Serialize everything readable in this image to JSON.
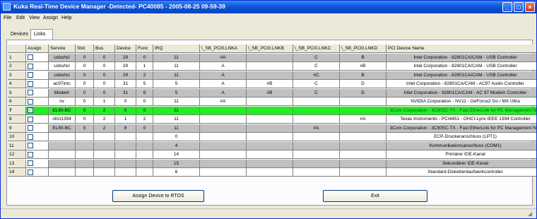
{
  "window": {
    "title": "Kuka Real-Time Device Manager -Detected- PC40085 - 2005-08-25 09-59-39"
  },
  "menu": [
    "File",
    "Edit",
    "View",
    "Assign",
    "Help"
  ],
  "tabs": [
    "Devices",
    "Links"
  ],
  "columns": [
    "Assign",
    "Service",
    "Slot",
    "Bus",
    "Device",
    "Func",
    "IRQ",
    "\\_SB_PCI0.LNKA",
    "\\_SB_PCI0.LNKB",
    "\\_SB_PCI0.LNKC",
    "\\_SB_PCI0.LNKD",
    "PCI Device Name"
  ],
  "rows": [
    {
      "num": "1",
      "checked": false,
      "service": "usbuhci",
      "slot": "0",
      "bus": "0",
      "device": "29",
      "func": "0",
      "irq": "11",
      "lnka": "#A",
      "lnkb": "",
      "lnkc": "C",
      "lnkd": "B",
      "name": "Intel Corporation - 82801CA/CAM - USB Controller",
      "bg": "#c0c0c0"
    },
    {
      "num": "2",
      "checked": false,
      "service": "usbuhci",
      "slot": "0",
      "bus": "0",
      "device": "29",
      "func": "1",
      "irq": "11",
      "lnka": "A",
      "lnkb": "",
      "lnkc": "C",
      "lnkd": "#B",
      "name": "Intel Corporation - 82801CA/CAM - USB Controller",
      "bg": "#ffffff"
    },
    {
      "num": "3",
      "checked": false,
      "service": "usbuhci",
      "slot": "0",
      "bus": "0",
      "device": "29",
      "func": "2",
      "irq": "11",
      "lnka": "A",
      "lnkb": "",
      "lnkc": "#C",
      "lnkd": "B",
      "name": "Intel Corporation - 82801CA/CAM - USB Controller",
      "bg": "#c0c0c0"
    },
    {
      "num": "4",
      "checked": false,
      "service": "ac97intc",
      "slot": "0",
      "bus": "0",
      "device": "31",
      "func": "5",
      "irq": "5",
      "lnka": "A",
      "lnkb": "#B",
      "lnkc": "C",
      "lnkd": "D",
      "name": "Intel Corporation - 82801CA/CAM - AC97 Audio Controller",
      "bg": "#ffffff"
    },
    {
      "num": "5",
      "checked": false,
      "service": "Modem",
      "slot": "0",
      "bus": "0",
      "device": "31",
      "func": "6",
      "irq": "5",
      "lnka": "A",
      "lnkb": "#B",
      "lnkc": "C",
      "lnkd": "D",
      "name": "Intel Corporation - 82801CA/CAM - AC 97 Modem Controller",
      "bg": "#c0c0c0"
    },
    {
      "num": "6",
      "checked": false,
      "service": "nv",
      "slot": "0",
      "bus": "1",
      "device": "0",
      "func": "0",
      "irq": "11",
      "lnka": "#A",
      "lnkb": "",
      "lnkc": "",
      "lnkd": "",
      "name": "NVIDIA Corporation - NV11 - GeForce2 Go / MX Ultra",
      "bg": "#ffffff"
    },
    {
      "num": "7",
      "checked": true,
      "service": "EL90-BC",
      "slot": "0",
      "bus": "2",
      "device": "0",
      "func": "0",
      "irq": "11",
      "lnka": "",
      "lnkb": "",
      "lnkc": "",
      "lnkd": "",
      "name": "3Com Corporation - 3C905C-TX - Fast EtherLink for PC Management NIC",
      "bg": "#22ee22"
    },
    {
      "num": "8",
      "checked": false,
      "service": "ohci1394",
      "slot": "0",
      "bus": "2",
      "device": "1",
      "func": "2",
      "irq": "11",
      "lnka": "",
      "lnkb": "",
      "lnkc": "",
      "lnkd": "#A",
      "name": "Texas Instruments - PCI4451 - OHCI-Lynx IEEE 1394 Controller",
      "bg": "#ffffff"
    },
    {
      "num": "9",
      "checked": false,
      "service": "EL90-BC",
      "slot": "0",
      "bus": "2",
      "device": "8",
      "func": "0",
      "irq": "11",
      "lnka": "",
      "lnkb": "",
      "lnkc": "#A",
      "lnkd": "",
      "name": "3Com Corporation - 3C905C-TX - Fast EtherLink for PC Management NIC",
      "bg": "#c0c0c0"
    },
    {
      "num": "10",
      "checked": false,
      "service": "",
      "slot": "",
      "bus": "",
      "device": "",
      "func": "",
      "irq": "0",
      "lnka": "",
      "lnkb": "",
      "lnkc": "",
      "lnkd": "",
      "name": "ECP-Druckeranschluss (LPT1)",
      "bg": "#ffffff"
    },
    {
      "num": "11",
      "checked": false,
      "service": "",
      "slot": "",
      "bus": "",
      "device": "",
      "func": "",
      "irq": "4",
      "lnka": "",
      "lnkb": "",
      "lnkc": "",
      "lnkd": "",
      "name": "Kommunikationsanschluss (COM1)",
      "bg": "#c0c0c0"
    },
    {
      "num": "12",
      "checked": false,
      "service": "",
      "slot": "",
      "bus": "",
      "device": "",
      "func": "",
      "irq": "14",
      "lnka": "",
      "lnkb": "",
      "lnkc": "",
      "lnkd": "",
      "name": "Primärer IDE-Kanal",
      "bg": "#ffffff"
    },
    {
      "num": "13",
      "checked": false,
      "service": "",
      "slot": "",
      "bus": "",
      "device": "",
      "func": "",
      "irq": "15",
      "lnka": "",
      "lnkb": "",
      "lnkc": "",
      "lnkd": "",
      "name": "Sekundärer IDE-Kanal",
      "bg": "#c0c0c0"
    },
    {
      "num": "14",
      "checked": false,
      "service": "",
      "slot": "",
      "bus": "",
      "device": "",
      "func": "",
      "irq": "6",
      "lnka": "",
      "lnkb": "",
      "lnkc": "",
      "lnkd": "",
      "name": "Standard-Diskettenlaufwerkcontroller",
      "bg": "#ffffff"
    }
  ],
  "buttons": {
    "assign": "Assign Device to RTOS",
    "exit": "Exit"
  },
  "colors": {
    "selected_row": "#22ee22",
    "alt_row": "#c0c0c0",
    "title_bar": "#0a52d8"
  }
}
